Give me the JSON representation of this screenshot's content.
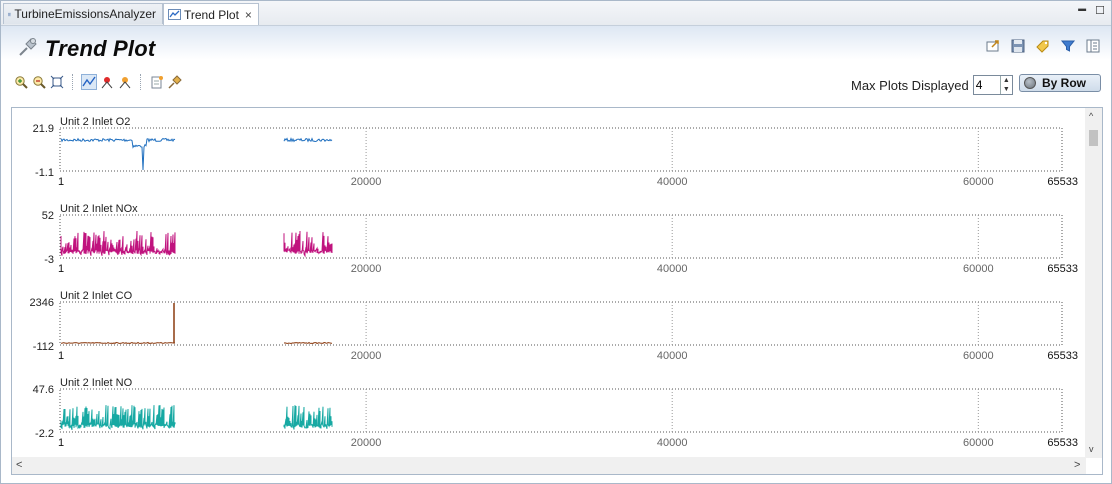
{
  "tabs": [
    {
      "label": "TurbineEmissionsAnalyzer",
      "icon": "table-icon",
      "active": false
    },
    {
      "label": "Trend Plot",
      "icon": "line-chart-icon",
      "active": true,
      "close": "×"
    }
  ],
  "window_buttons": {
    "minimize": "▬",
    "maximize": "☐"
  },
  "header": {
    "title": "Trend Plot",
    "icon": "pin-icon"
  },
  "header_icons": [
    "export-icon",
    "save-icon",
    "tag-icon",
    "filter-icon",
    "layout-icon"
  ],
  "toolbar": {
    "tools": [
      "zoom-in-icon",
      "zoom-out-icon",
      "fit-icon",
      "line-mode-icon",
      "marker-red-icon",
      "marker-orange-icon",
      "notes-icon",
      "pin-tool-icon"
    ],
    "max_plots_label": "Max Plots Displayed",
    "max_plots_value": "4",
    "by_row_label": "By Row"
  },
  "plots": [
    {
      "title": "Unit 2 Inlet O2",
      "ymax": "21.9",
      "ymin": "-1.1",
      "color": "#1f6fbf"
    },
    {
      "title": "Unit 2 Inlet NOx",
      "ymax": "52",
      "ymin": "-3",
      "color": "#c0137e"
    },
    {
      "title": "Unit 2 Inlet CO",
      "ymax": "2346",
      "ymin": "-112",
      "color": "#8b3a0f"
    },
    {
      "title": "Unit 2 Inlet NO",
      "ymax": "47.6",
      "ymin": "-2.2",
      "color": "#17a9a3"
    }
  ],
  "x_axis": {
    "min": "1",
    "ticks": [
      "20000",
      "40000",
      "60000"
    ],
    "max": "65533"
  },
  "scroll": {
    "left": "<",
    "right": ">",
    "up": "^",
    "down": "v"
  }
}
